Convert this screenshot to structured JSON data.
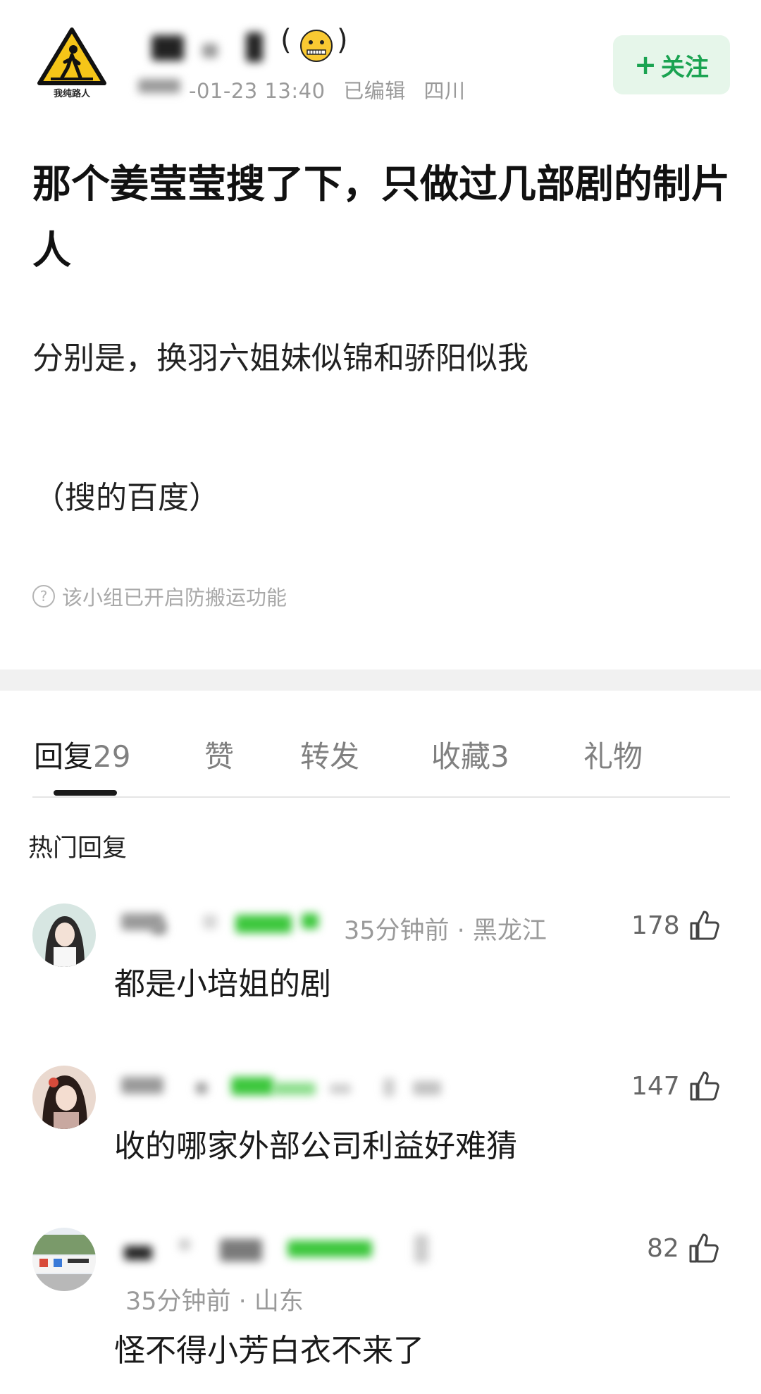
{
  "header": {
    "avatar_label": "我纯路人",
    "username_emoji": "🤐",
    "paren_open": "(",
    "paren_close": ")",
    "meta_date": "-01-23 13:40",
    "meta_edited": "已编辑",
    "meta_location": "四川",
    "follow_plus": "+",
    "follow_label": "关注"
  },
  "post": {
    "title": "那个姜莹莹搜了下，只做过几部剧的制片人",
    "body_1": "分别是，换羽六姐妹似锦和骄阳似我",
    "body_2": "（搜的百度）",
    "notice": "该小组已开启防搬运功能"
  },
  "tabs": [
    {
      "label": "回复",
      "count": "29"
    },
    {
      "label": "赞",
      "count": ""
    },
    {
      "label": "转发",
      "count": ""
    },
    {
      "label": "收藏",
      "count": "3"
    },
    {
      "label": "礼物",
      "count": ""
    }
  ],
  "hot_label": "热门回复",
  "comments": [
    {
      "time": "35分钟前 · 黑龙江",
      "text": "都是小培姐的剧",
      "likes": "178"
    },
    {
      "time": "",
      "text": "收的哪家外部公司利益好难猜",
      "likes": "147"
    },
    {
      "time": "35分钟前 · 山东",
      "text": "怪不得小芳白衣不来了",
      "likes": "82"
    }
  ],
  "colors": {
    "accent_green": "#1aa351",
    "follow_bg": "#e6f6ea",
    "meta_gray": "#9a9a9a"
  }
}
